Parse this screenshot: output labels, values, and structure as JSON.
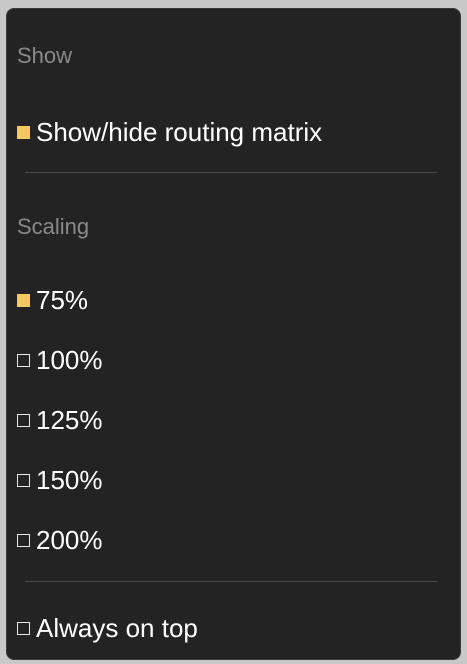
{
  "show_section": {
    "header": "Show",
    "items": [
      {
        "label": "Show/hide routing matrix",
        "checked": true
      }
    ]
  },
  "scaling_section": {
    "header": "Scaling",
    "items": [
      {
        "label": "75%",
        "checked": true
      },
      {
        "label": "100%",
        "checked": false
      },
      {
        "label": "125%",
        "checked": false
      },
      {
        "label": "150%",
        "checked": false
      },
      {
        "label": "200%",
        "checked": false
      }
    ]
  },
  "window_section": {
    "items": [
      {
        "label": "Always on top",
        "checked": false
      }
    ]
  },
  "colors": {
    "background": "#232323",
    "checked": "#f5c962",
    "header_text": "#8a8a8a",
    "item_text": "#ffffff"
  }
}
